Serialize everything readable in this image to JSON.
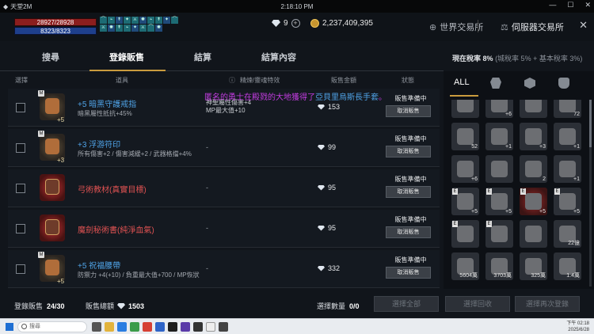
{
  "window": {
    "title": "天堂2M",
    "clock": "2:18:10 PM"
  },
  "hud": {
    "hp": "28927/28928",
    "mp": "8323/8323",
    "gems": "9",
    "gold": "2,237,409,395"
  },
  "buffs": [
    "⌒",
    "⌁",
    "↟",
    "✦",
    "⚔",
    "✺",
    "⌁",
    "↟",
    "✦",
    "⌒",
    "⚔",
    "✺",
    "↟",
    "⌁",
    "✦",
    "⚔",
    "⌒",
    "✺"
  ],
  "nav": {
    "world_exchange": "世界交易所",
    "server_exchange": "伺服器交易所"
  },
  "tabs": [
    "搜尋",
    "登錄販售",
    "結算",
    "結算內容"
  ],
  "tax": {
    "label": "現在稅率",
    "value": "8%",
    "detail": "(城稅率 5% + 基本稅率 3%)"
  },
  "columns": {
    "select": "選擇",
    "item": "道具",
    "enchant": "精煉/靈魂特效",
    "price": "販售金額",
    "status": "狀態"
  },
  "notice": {
    "prefix": "匿名的勇士在殿戮的大地獲得了",
    "item": "亞貝里烏斯長手套",
    "suffix": "。"
  },
  "rows": [
    {
      "name": "+5 暗黑守護戒指",
      "plus": "+5",
      "stat": "暗黑屬性抵抗+45%",
      "ench": [
        "神聖屬性傷害+4",
        "MP最大值+10"
      ],
      "price": "153",
      "status": "販售準備中",
      "cancel": "取消販售",
      "red": false
    },
    {
      "name": "+3 浮游符印",
      "plus": "+3",
      "stat": "所有傷害+2 / 傷害減緩+2 / 武器格擋+4%",
      "ench": [
        "-"
      ],
      "price": "99",
      "status": "販售準備中",
      "cancel": "取消販售",
      "red": false
    },
    {
      "name": "弓術教材(真實目標)",
      "plus": "",
      "stat": "",
      "ench": [
        "-"
      ],
      "price": "95",
      "status": "販售準備中",
      "cancel": "取消販售",
      "red": true
    },
    {
      "name": "魔劍秘術書(純淨血氣)",
      "plus": "",
      "stat": "",
      "ench": [
        "-"
      ],
      "price": "95",
      "status": "販售準備中",
      "cancel": "取消販售",
      "red": true
    },
    {
      "name": "+5 祝福腰帶",
      "plus": "+5",
      "stat": "防禦力 +4(+10) / 負重最大值+700 / MP恢狀",
      "ench": [
        "-"
      ],
      "price": "332",
      "status": "販售準備中",
      "cancel": "取消販售",
      "red": false
    }
  ],
  "footer": {
    "registered_label": "登錄販售",
    "registered": "24/30",
    "total_label": "販售總額",
    "total": "1503",
    "selected_label": "選擇數量",
    "selected": "0/0",
    "btn_all": "選擇全部",
    "btn_collect": "選擇回收",
    "btn_reregister": "選擇再次登錄"
  },
  "inventory": {
    "tab_all": "ALL",
    "slots": [
      {
        "cnt": "",
        "red": false,
        "e": false
      },
      {
        "cnt": "+6",
        "red": false,
        "e": false
      },
      {
        "cnt": "",
        "red": false,
        "e": false
      },
      {
        "cnt": "72",
        "red": false,
        "e": false
      },
      {
        "cnt": "52",
        "red": false,
        "e": false
      },
      {
        "cnt": "+1",
        "red": false,
        "e": false
      },
      {
        "cnt": "+3",
        "red": false,
        "e": false
      },
      {
        "cnt": "+1",
        "red": false,
        "e": false
      },
      {
        "cnt": "+6",
        "red": false,
        "e": false
      },
      {
        "cnt": "",
        "red": false,
        "e": false
      },
      {
        "cnt": "2",
        "red": false,
        "e": false
      },
      {
        "cnt": "+1",
        "red": false,
        "e": false
      },
      {
        "cnt": "+5",
        "red": false,
        "e": true
      },
      {
        "cnt": "+5",
        "red": false,
        "e": true
      },
      {
        "cnt": "+5",
        "red": true,
        "e": true
      },
      {
        "cnt": "+5",
        "red": false,
        "e": true
      },
      {
        "cnt": "",
        "red": false,
        "e": true
      },
      {
        "cnt": "",
        "red": false,
        "e": true
      },
      {
        "cnt": "",
        "red": false,
        "e": false
      },
      {
        "cnt": "22億",
        "red": false,
        "e": false
      },
      {
        "cnt": "5604萬",
        "red": false,
        "e": false
      },
      {
        "cnt": "3703萬",
        "red": false,
        "e": false
      },
      {
        "cnt": "325萬",
        "red": false,
        "e": false
      },
      {
        "cnt": "1.4萬",
        "red": false,
        "e": false
      }
    ]
  },
  "taskbar": {
    "search": "搜尋",
    "time": "下午 02:18",
    "date": "2025/6/28"
  }
}
